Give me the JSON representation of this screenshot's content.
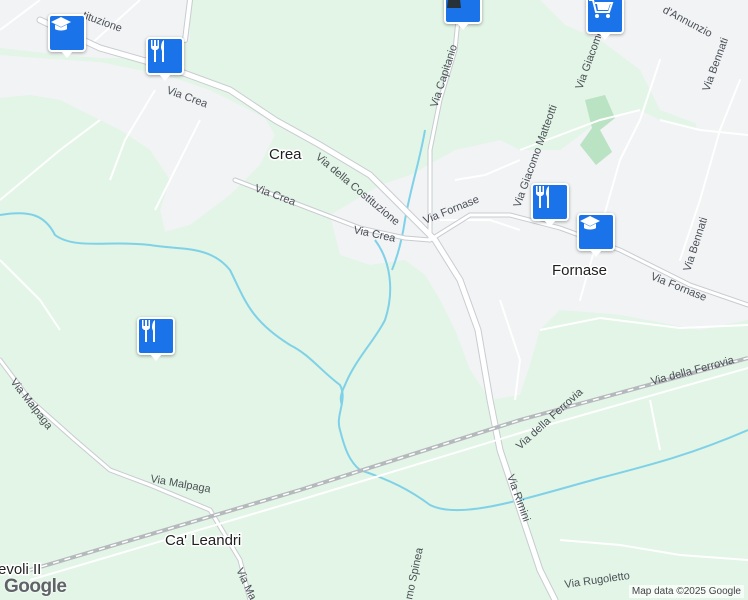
{
  "map": {
    "places": {
      "crea": "Crea",
      "fornase": "Fornase",
      "ca_leandri": "Ca' Leandri",
      "cut_left": "evoli II"
    },
    "roads": {
      "via_costituzione_top": "tituzione",
      "via_crea_1": "Via Crea",
      "via_costituzione": "Via della Costituzione",
      "via_crea_2": "Via Crea",
      "via_crea_3": "Via Crea",
      "via_fornase_1": "Via Fornase",
      "via_fornase_2": "Via Fornase",
      "via_capitanio": "Via Capitanio",
      "via_matteotti": "Via Giacomo Matteotti",
      "via_giacomo_cut": "Via Giacomo",
      "via_annunzio": "d'Annunzio",
      "via_bennati_1": "Via Bennati",
      "via_bennati_2": "Via Bennati",
      "via_ferrovia_1": "Via della Ferrovia",
      "via_ferrovia_2": "Via della Ferrovia",
      "via_malpaga_1": "Via Malpaga",
      "via_malpaga_2": "Via Malpaga",
      "via_malpaga_3": "Via Ma",
      "via_rimini": "Via Rimini",
      "via_spinea": "mo Spinea",
      "via_rugoletto": "Via Rugoletto"
    },
    "markers": [
      {
        "type": "school-icon",
        "color": "#1a73e8"
      },
      {
        "type": "restaurant-icon",
        "color": "#1a73e8"
      },
      {
        "type": "store-icon",
        "color": "#1a73e8"
      },
      {
        "type": "restaurant-icon",
        "color": "#1a73e8"
      },
      {
        "type": "school-icon",
        "color": "#1a73e8"
      },
      {
        "type": "restaurant-icon",
        "color": "#1a73e8"
      },
      {
        "type": "store-icon",
        "color": "#1a73e8"
      }
    ],
    "logo": "Google",
    "attribution": "Map data ©2025 Google",
    "colors": {
      "land": "#e2f5e6",
      "urban": "#f1f3f4",
      "park": "#b9e3c2",
      "water": "#7fd1e8",
      "road": "#ffffff",
      "road_casing": "#c8ccd1",
      "rail": "#b5b8bc",
      "marker": "#1a73e8"
    }
  }
}
